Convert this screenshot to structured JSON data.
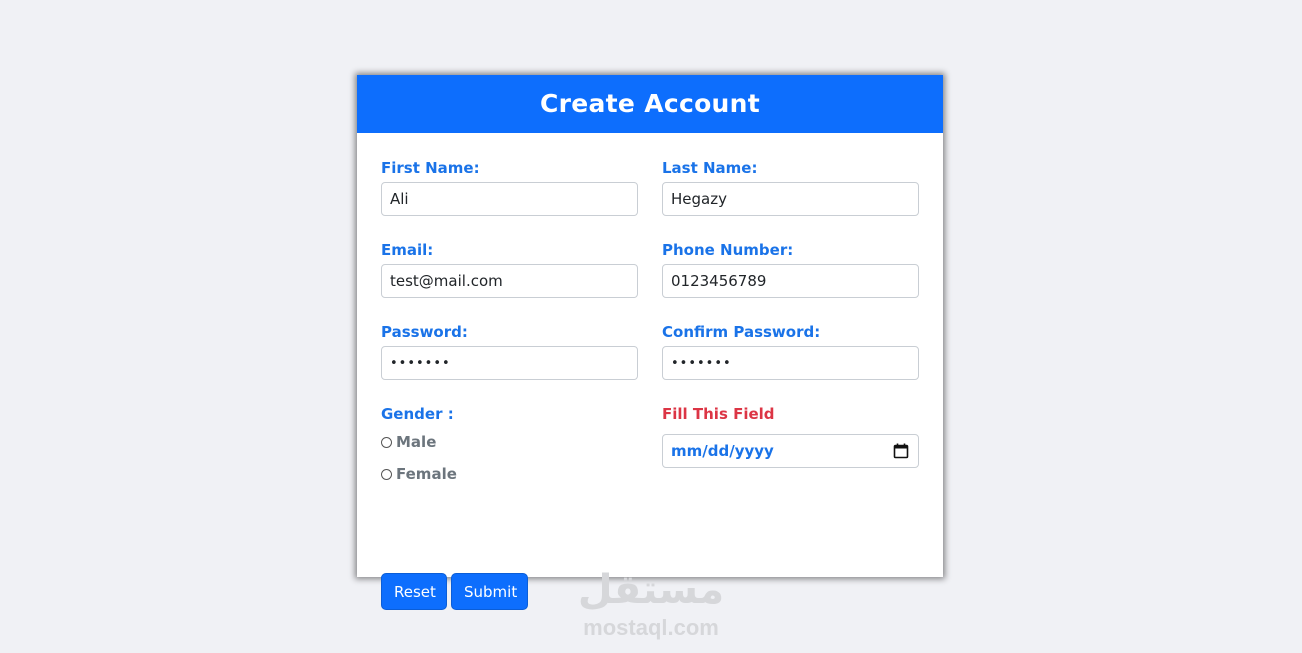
{
  "form": {
    "title": "Create Account",
    "first_name": {
      "label": "First Name:",
      "value": "Ali"
    },
    "last_name": {
      "label": "Last Name:",
      "value": "Hegazy"
    },
    "email": {
      "label": "Email:",
      "value": "test@mail.com"
    },
    "phone": {
      "label": "Phone Number:",
      "value": "0123456789"
    },
    "password": {
      "label": "Password:",
      "value": "•••••••"
    },
    "confirm_password": {
      "label": "Confirm Password:",
      "value": "•••••••"
    },
    "gender": {
      "label": "Gender :",
      "options": [
        "Male",
        "Female"
      ]
    },
    "date": {
      "label": "Fill This Field",
      "placeholder": "mm/dd/yyyy",
      "icon": "calendar-icon"
    },
    "buttons": {
      "reset": "Reset",
      "submit": "Submit"
    }
  },
  "colors": {
    "primary": "#0d6efd",
    "label": "#1a73e8",
    "error": "#dc3545",
    "background": "#f0f1f5"
  },
  "watermark": {
    "logo": "مستقل",
    "text": "mostaql.com"
  }
}
